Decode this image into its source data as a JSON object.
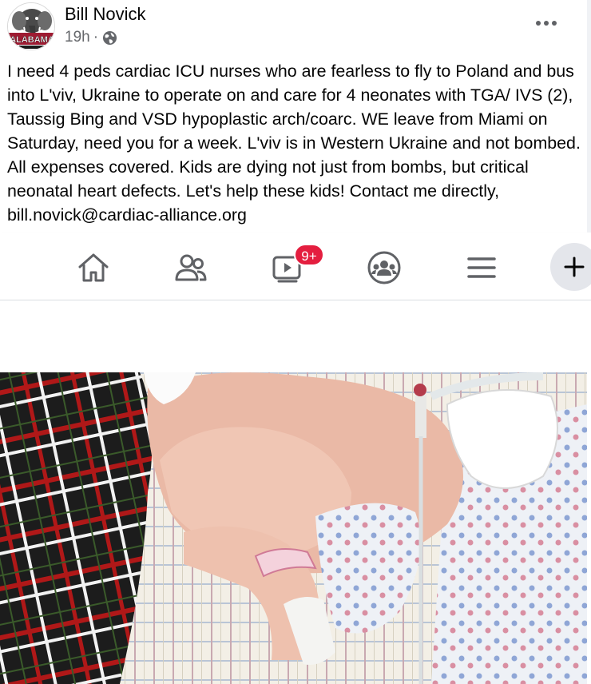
{
  "post": {
    "author": "Bill Novick",
    "time": "19h",
    "separator": "·",
    "avatar_text": "ALABAMA",
    "text": "I need 4 peds cardiac ICU nurses who are fearless to fly to Poland and bus into L'viv, Ukraine to operate on and care for 4 neonates with TGA/ IVS (2), Taussig Bing and VSD hypoplastic arch/coarc. WE leave from Miami on Saturday,  need you for a week. L'viv is in Western Ukraine and not bombed. All expenses covered. Kids are dying not just from bombs, but critical neonatal heart defects. Let's help these kids! Contact me directly, bill.novick@cardiac-alliance.org",
    "privacy_icon": "globe-icon",
    "more_icon": "more-horizontal-icon"
  },
  "nav": {
    "items": [
      {
        "icon": "home-icon"
      },
      {
        "icon": "friends-icon"
      },
      {
        "icon": "watch-video-icon"
      },
      {
        "icon": "groups-icon"
      },
      {
        "icon": "menu-icon"
      }
    ],
    "watch_badge": "9+",
    "fab_icon": "plus-icon"
  },
  "colors": {
    "text": "#050505",
    "secondary_text": "#65676b",
    "badge": "#e41e3f",
    "icon": "#606266"
  }
}
